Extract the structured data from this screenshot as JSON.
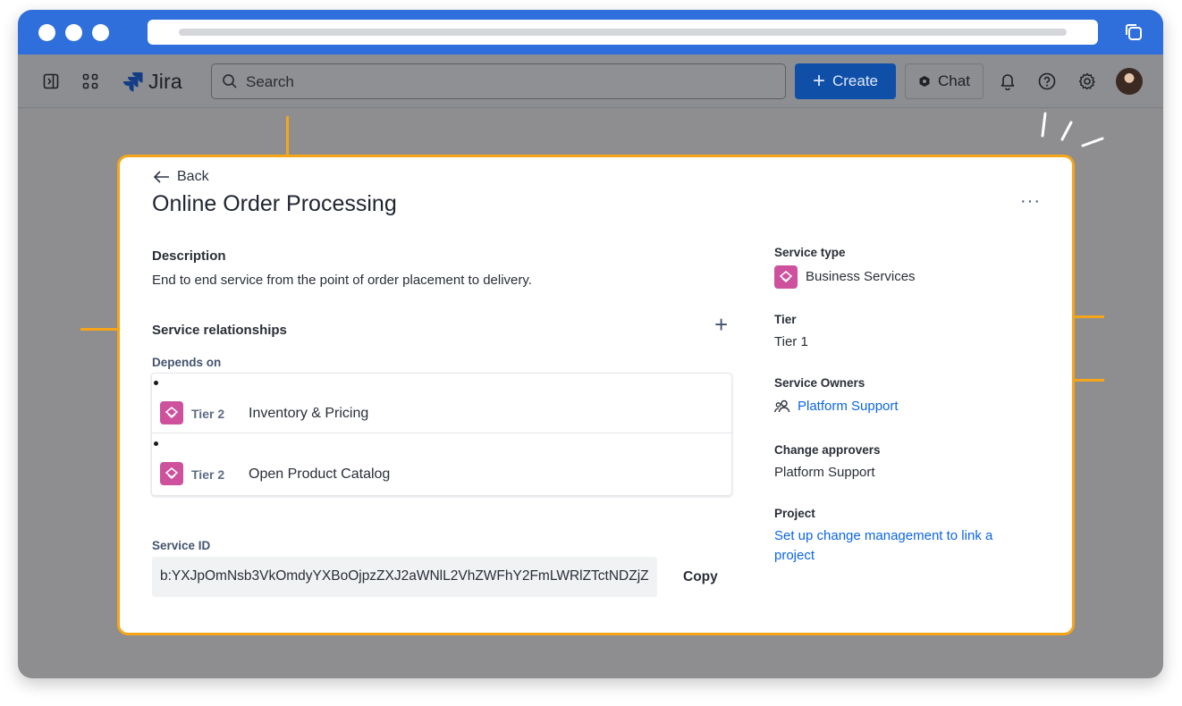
{
  "browser": {
    "window_controls": [
      "close",
      "minimize",
      "maximize"
    ]
  },
  "navbar": {
    "app_name": "Jira",
    "search_placeholder": "Search",
    "create_label": "Create",
    "chat_label": "Chat"
  },
  "colors": {
    "chrome_blue": "#2f6fdb",
    "callout_orange": "#f6a519",
    "create_blue": "#0f4fa8",
    "service_icon_pink": "#cd519d",
    "link_blue": "#0c66e4"
  },
  "icons": [
    "sidebar-toggle-icon",
    "app-switcher-icon",
    "jira-logo-icon",
    "search-icon",
    "plus-icon",
    "chat-icon",
    "bell-icon",
    "help-icon",
    "gear-icon",
    "avatar",
    "back-arrow-icon",
    "more-icon",
    "service-icon",
    "people-icon"
  ],
  "service": {
    "back_label": "Back",
    "name": "Online Order Processing",
    "more_label": "···",
    "description_heading": "Description",
    "description": "End to end service from the point of order placement to delivery.",
    "relationships_heading": "Service relationships",
    "add_label": "+",
    "depends_on_label": "Depends on",
    "dependencies": [
      {
        "tier": "Tier 2",
        "name": "Inventory & Pricing"
      },
      {
        "tier": "Tier 2",
        "name": "Open Product Catalog"
      }
    ],
    "service_id_label": "Service ID",
    "service_id": "b:YXJpOmNsb3VkOmdyYXBoOjpzZXJ2aWNlL2VhZWFhY2FmLWRlZTctNDZjZ",
    "copy_label": "Copy"
  },
  "details": {
    "service_type_label": "Service type",
    "service_type": "Business Services",
    "tier_label": "Tier",
    "tier": "Tier 1",
    "owners_label": "Service Owners",
    "owner": "Platform Support",
    "approvers_label": "Change approvers",
    "approver": "Platform Support",
    "project_label": "Project",
    "project_link_line1": "Set up change management to link a",
    "project_link_line2": "project"
  }
}
